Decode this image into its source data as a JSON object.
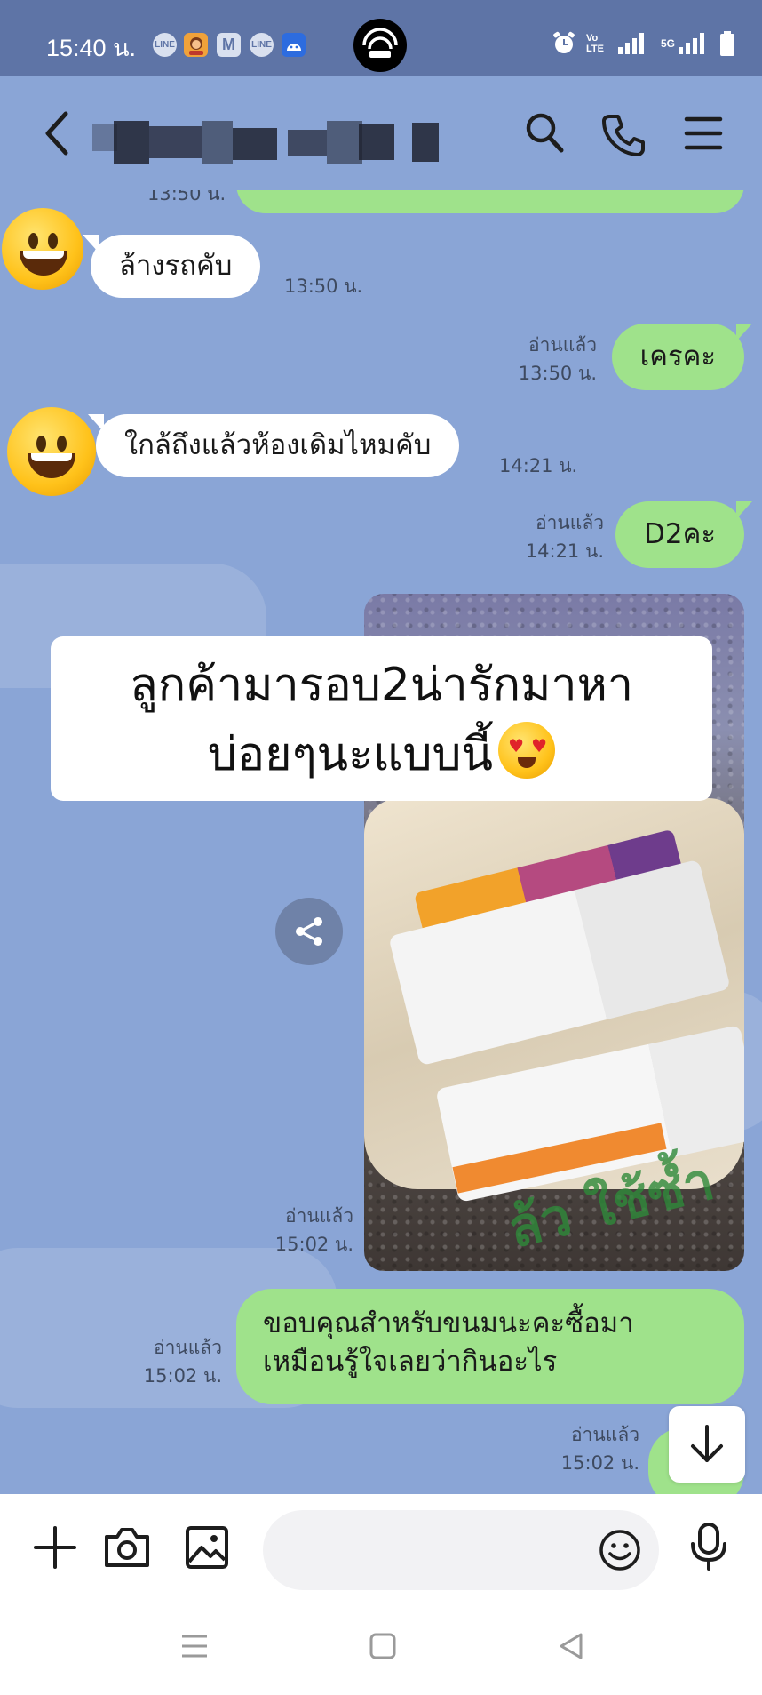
{
  "status_bar": {
    "time": "15:40 น.",
    "notifications": [
      "LINE",
      "game",
      "M",
      "LINE",
      "android"
    ],
    "hotspot_brackets": "(      )",
    "network": "Vo LTE",
    "network2": "5G"
  },
  "header": {
    "back_icon": "chevron-left-icon",
    "search_icon": "search-icon",
    "call_icon": "phone-icon",
    "menu_icon": "menu-icon"
  },
  "messages": [
    {
      "id": "m0",
      "side": "out",
      "text": "",
      "partial": true
    },
    {
      "id": "m0_time",
      "text": "13:50 น."
    },
    {
      "id": "m1",
      "side": "in",
      "text": "ล้างรถคับ",
      "time": "13:50 น."
    },
    {
      "id": "m2",
      "side": "out",
      "text": "เครคะ",
      "read": "อ่านแล้ว",
      "time": "13:50 น."
    },
    {
      "id": "m3",
      "side": "in",
      "text": "ใกล้ถึงแล้วห้องเดิมไหมคับ",
      "time": "14:21 น."
    },
    {
      "id": "m4",
      "side": "out",
      "text": "D2คะ",
      "read": "อ่านแล้ว",
      "time": "14:21 น."
    },
    {
      "id": "m5",
      "side": "out",
      "type": "photo",
      "read": "อ่านแล้ว",
      "time": "15:02 น."
    },
    {
      "id": "m6",
      "side": "out",
      "lines": [
        "ขอบคุณสำหรับขนมนะคะซื้อมา",
        "เหมือนรู้ใจเลยว่ากินอะไร"
      ],
      "read": "อ่านแล้ว",
      "time": "15:02 น."
    },
    {
      "id": "m7",
      "side": "out",
      "text": "",
      "read": "อ่านแล้ว",
      "time": "15:02 น.",
      "partial": true
    }
  ],
  "photo": {
    "bag_text": "ล้ว ใช้ซ้ำ"
  },
  "overlay": {
    "line1": "ลูกค้ามารอบ2น่ารักมาหา",
    "line2": "บ่อยๆนะแบบนี้"
  },
  "input": {
    "placeholder": ""
  },
  "colors": {
    "chat_background": "#8aa5d6",
    "status_bar": "#5e74a6",
    "outgoing_bubble": "#9fe28b",
    "incoming_bubble": "#ffffff"
  }
}
